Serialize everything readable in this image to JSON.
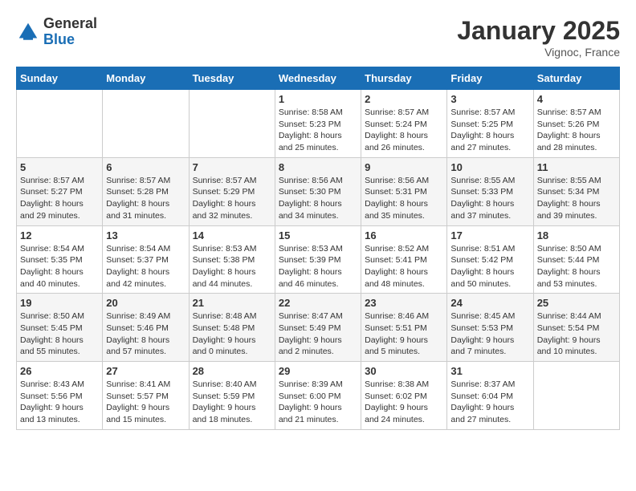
{
  "logo": {
    "general": "General",
    "blue": "Blue"
  },
  "title": "January 2025",
  "location": "Vignoc, France",
  "days_of_week": [
    "Sunday",
    "Monday",
    "Tuesday",
    "Wednesday",
    "Thursday",
    "Friday",
    "Saturday"
  ],
  "weeks": [
    [
      {
        "day": "",
        "info": ""
      },
      {
        "day": "",
        "info": ""
      },
      {
        "day": "",
        "info": ""
      },
      {
        "day": "1",
        "info": "Sunrise: 8:58 AM\nSunset: 5:23 PM\nDaylight: 8 hours\nand 25 minutes."
      },
      {
        "day": "2",
        "info": "Sunrise: 8:57 AM\nSunset: 5:24 PM\nDaylight: 8 hours\nand 26 minutes."
      },
      {
        "day": "3",
        "info": "Sunrise: 8:57 AM\nSunset: 5:25 PM\nDaylight: 8 hours\nand 27 minutes."
      },
      {
        "day": "4",
        "info": "Sunrise: 8:57 AM\nSunset: 5:26 PM\nDaylight: 8 hours\nand 28 minutes."
      }
    ],
    [
      {
        "day": "5",
        "info": "Sunrise: 8:57 AM\nSunset: 5:27 PM\nDaylight: 8 hours\nand 29 minutes."
      },
      {
        "day": "6",
        "info": "Sunrise: 8:57 AM\nSunset: 5:28 PM\nDaylight: 8 hours\nand 31 minutes."
      },
      {
        "day": "7",
        "info": "Sunrise: 8:57 AM\nSunset: 5:29 PM\nDaylight: 8 hours\nand 32 minutes."
      },
      {
        "day": "8",
        "info": "Sunrise: 8:56 AM\nSunset: 5:30 PM\nDaylight: 8 hours\nand 34 minutes."
      },
      {
        "day": "9",
        "info": "Sunrise: 8:56 AM\nSunset: 5:31 PM\nDaylight: 8 hours\nand 35 minutes."
      },
      {
        "day": "10",
        "info": "Sunrise: 8:55 AM\nSunset: 5:33 PM\nDaylight: 8 hours\nand 37 minutes."
      },
      {
        "day": "11",
        "info": "Sunrise: 8:55 AM\nSunset: 5:34 PM\nDaylight: 8 hours\nand 39 minutes."
      }
    ],
    [
      {
        "day": "12",
        "info": "Sunrise: 8:54 AM\nSunset: 5:35 PM\nDaylight: 8 hours\nand 40 minutes."
      },
      {
        "day": "13",
        "info": "Sunrise: 8:54 AM\nSunset: 5:37 PM\nDaylight: 8 hours\nand 42 minutes."
      },
      {
        "day": "14",
        "info": "Sunrise: 8:53 AM\nSunset: 5:38 PM\nDaylight: 8 hours\nand 44 minutes."
      },
      {
        "day": "15",
        "info": "Sunrise: 8:53 AM\nSunset: 5:39 PM\nDaylight: 8 hours\nand 46 minutes."
      },
      {
        "day": "16",
        "info": "Sunrise: 8:52 AM\nSunset: 5:41 PM\nDaylight: 8 hours\nand 48 minutes."
      },
      {
        "day": "17",
        "info": "Sunrise: 8:51 AM\nSunset: 5:42 PM\nDaylight: 8 hours\nand 50 minutes."
      },
      {
        "day": "18",
        "info": "Sunrise: 8:50 AM\nSunset: 5:44 PM\nDaylight: 8 hours\nand 53 minutes."
      }
    ],
    [
      {
        "day": "19",
        "info": "Sunrise: 8:50 AM\nSunset: 5:45 PM\nDaylight: 8 hours\nand 55 minutes."
      },
      {
        "day": "20",
        "info": "Sunrise: 8:49 AM\nSunset: 5:46 PM\nDaylight: 8 hours\nand 57 minutes."
      },
      {
        "day": "21",
        "info": "Sunrise: 8:48 AM\nSunset: 5:48 PM\nDaylight: 9 hours\nand 0 minutes."
      },
      {
        "day": "22",
        "info": "Sunrise: 8:47 AM\nSunset: 5:49 PM\nDaylight: 9 hours\nand 2 minutes."
      },
      {
        "day": "23",
        "info": "Sunrise: 8:46 AM\nSunset: 5:51 PM\nDaylight: 9 hours\nand 5 minutes."
      },
      {
        "day": "24",
        "info": "Sunrise: 8:45 AM\nSunset: 5:53 PM\nDaylight: 9 hours\nand 7 minutes."
      },
      {
        "day": "25",
        "info": "Sunrise: 8:44 AM\nSunset: 5:54 PM\nDaylight: 9 hours\nand 10 minutes."
      }
    ],
    [
      {
        "day": "26",
        "info": "Sunrise: 8:43 AM\nSunset: 5:56 PM\nDaylight: 9 hours\nand 13 minutes."
      },
      {
        "day": "27",
        "info": "Sunrise: 8:41 AM\nSunset: 5:57 PM\nDaylight: 9 hours\nand 15 minutes."
      },
      {
        "day": "28",
        "info": "Sunrise: 8:40 AM\nSunset: 5:59 PM\nDaylight: 9 hours\nand 18 minutes."
      },
      {
        "day": "29",
        "info": "Sunrise: 8:39 AM\nSunset: 6:00 PM\nDaylight: 9 hours\nand 21 minutes."
      },
      {
        "day": "30",
        "info": "Sunrise: 8:38 AM\nSunset: 6:02 PM\nDaylight: 9 hours\nand 24 minutes."
      },
      {
        "day": "31",
        "info": "Sunrise: 8:37 AM\nSunset: 6:04 PM\nDaylight: 9 hours\nand 27 minutes."
      },
      {
        "day": "",
        "info": ""
      }
    ]
  ]
}
